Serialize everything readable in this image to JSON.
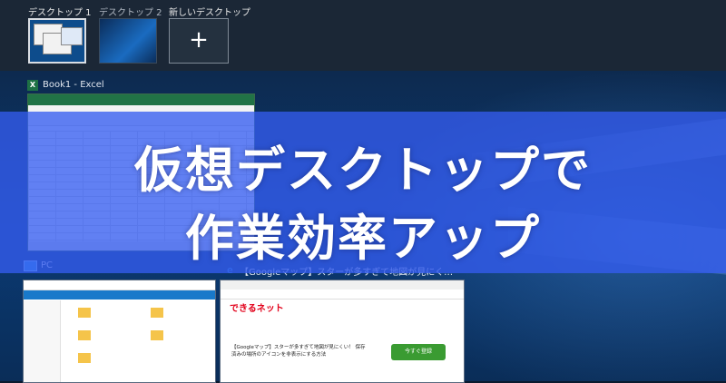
{
  "desktops": {
    "items": [
      {
        "label": "デスクトップ 1"
      },
      {
        "label": "デスクトップ 2"
      }
    ],
    "new_label": "新しいデスクトップ",
    "new_icon": "plus-icon"
  },
  "windows": {
    "excel_title": "Book1 - Excel",
    "pc_title": "PC",
    "browser_title": "【Googleマップ】スターが多すぎて地図が見にくい！ 保存済みの場所の..."
  },
  "browser_content": {
    "brand": "できるネット",
    "article": "【Googleマップ】スターが多すぎて地図が見にくい！ 保存済みの場所のアイコンを非表示にする方法",
    "cta": "今すぐ登録"
  },
  "banner": {
    "line1": "仮想デスクトップで",
    "line2": "作業効率アップ"
  },
  "colors": {
    "banner": "#345cf0",
    "excel_green": "#217346"
  }
}
